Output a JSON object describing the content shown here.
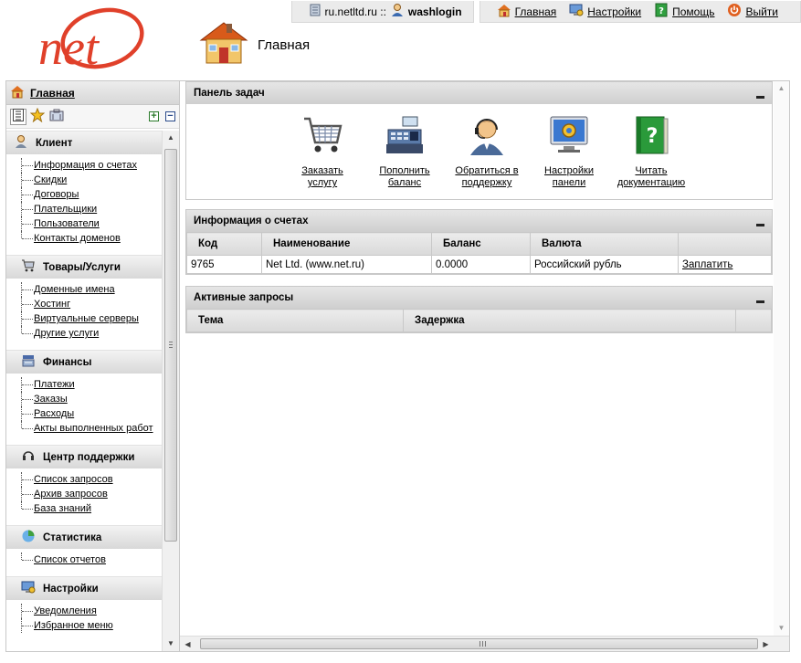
{
  "topbar": {
    "server": "ru.netltd.ru ::",
    "user": "washlogin",
    "links": [
      {
        "label": "Главная",
        "icon": "home-icon"
      },
      {
        "label": "Настройки",
        "icon": "monitor-settings-icon"
      },
      {
        "label": "Помощь",
        "icon": "help-icon"
      },
      {
        "label": "Выйти",
        "icon": "power-icon"
      }
    ]
  },
  "logo": {
    "text": "net",
    "color": "#e0402a"
  },
  "header": {
    "title": "Главная"
  },
  "sidebar": {
    "home_label": "Главная",
    "sections": [
      {
        "title": "Клиент",
        "icon": "client-icon",
        "items": [
          "Информация о счетах",
          "Скидки",
          "Договоры",
          "Плательщики",
          "Пользователи",
          "Контакты доменов"
        ]
      },
      {
        "title": "Товары/Услуги",
        "icon": "cart-icon",
        "items": [
          "Доменные имена",
          "Хостинг",
          "Виртуальные серверы",
          "Другие услуги"
        ]
      },
      {
        "title": "Финансы",
        "icon": "finance-icon",
        "items": [
          "Платежи",
          "Заказы",
          "Расходы",
          "Акты выполненных работ"
        ]
      },
      {
        "title": "Центр поддержки",
        "icon": "headset-icon",
        "items": [
          "Список запросов",
          "Архив запросов",
          "База знаний"
        ]
      },
      {
        "title": "Статистика",
        "icon": "stats-icon",
        "items": [
          "Список отчетов"
        ]
      },
      {
        "title": "Настройки",
        "icon": "settings-icon",
        "items": [
          "Уведомления",
          "Избранное меню"
        ]
      }
    ]
  },
  "taskpanel": {
    "title": "Панель задач",
    "tasks": [
      {
        "line1": "Заказать",
        "line2": "услугу",
        "icon": "cart-icon"
      },
      {
        "line1": "Пополнить",
        "line2": "баланс",
        "icon": "cash-register-icon"
      },
      {
        "line1": "Обратиться в",
        "line2": "поддержку",
        "icon": "support-operator-icon"
      },
      {
        "line1": "Настройки",
        "line2": "панели",
        "icon": "monitor-gear-icon"
      },
      {
        "line1": "Читать",
        "line2": "документацию",
        "icon": "help-book-icon"
      }
    ]
  },
  "accounts": {
    "title": "Информация о счетах",
    "columns": [
      "Код",
      "Наименование",
      "Баланс",
      "Валюта",
      ""
    ],
    "rows": [
      {
        "code": "9765",
        "name": "Net Ltd. (www.net.ru)",
        "balance": "0.0000",
        "currency": "Российский рубль",
        "action": "Заплатить"
      }
    ]
  },
  "requests": {
    "title": "Активные запросы",
    "columns": [
      "Тема",
      "Задержка",
      ""
    ]
  }
}
